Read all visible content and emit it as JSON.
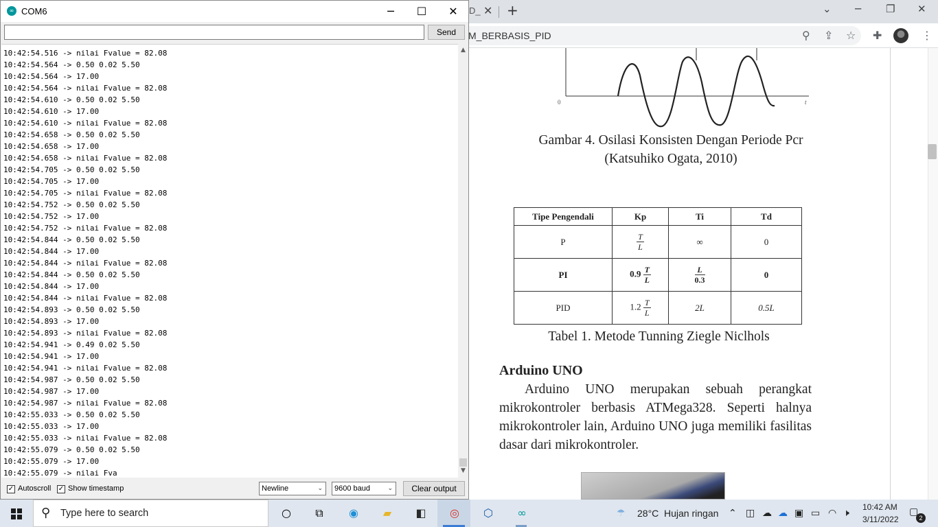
{
  "browser": {
    "tab_fragment": "D_",
    "url_fragment": "M_BERBASIS_PID",
    "document": {
      "figure_axis_origin": "0",
      "figure_axis_t": "t",
      "figure_caption_line1": "Gambar 4. Osilasi Konsisten Dengan Periode Pcr",
      "figure_caption_line2": "(Katsuhiko Ogata, 2010)",
      "table": {
        "headers": [
          "Tipe Pengendali",
          "Kp",
          "Ti",
          "Td"
        ],
        "rows": [
          {
            "type": "P",
            "kp_coef": "",
            "kp_num": "T",
            "kp_den": "L",
            "ti": "∞",
            "td": "0"
          },
          {
            "type": "PI",
            "kp_coef": "0.9",
            "kp_num": "T",
            "kp_den": "L",
            "ti_num": "L",
            "ti_den": "0.3",
            "td": "0"
          },
          {
            "type": "PID",
            "kp_coef": "1.2",
            "kp_num": "T",
            "kp_den": "L",
            "ti": "2L",
            "td": "0.5L"
          }
        ]
      },
      "table_caption": "Tabel 1. Metode Tunning Ziegle Niclhols",
      "section_title": "Arduino UNO",
      "paragraph": "Arduino UNO merupakan sebuah perangkat mikrokontroler berbasis ATMega328. Seperti halnya mikrokontroler lain, Arduino UNO juga memiliki fasilitas dasar dari mikrokontroler."
    }
  },
  "serial_monitor": {
    "title": "COM6",
    "input_value": "",
    "send_label": "Send",
    "lines": [
      "10:42:54.516 -> nilai Fvalue = 82.08",
      "10:42:54.564 -> 0.50 0.02 5.50",
      "10:42:54.564 -> 17.00",
      "10:42:54.564 -> nilai Fvalue = 82.08",
      "10:42:54.610 -> 0.50 0.02 5.50",
      "10:42:54.610 -> 17.00",
      "10:42:54.610 -> nilai Fvalue = 82.08",
      "10:42:54.658 -> 0.50 0.02 5.50",
      "10:42:54.658 -> 17.00",
      "10:42:54.658 -> nilai Fvalue = 82.08",
      "10:42:54.705 -> 0.50 0.02 5.50",
      "10:42:54.705 -> 17.00",
      "10:42:54.705 -> nilai Fvalue = 82.08",
      "10:42:54.752 -> 0.50 0.02 5.50",
      "10:42:54.752 -> 17.00",
      "10:42:54.752 -> nilai Fvalue = 82.08",
      "10:42:54.844 -> 0.50 0.02 5.50",
      "10:42:54.844 -> 17.00",
      "10:42:54.844 -> nilai Fvalue = 82.08",
      "10:42:54.844 -> 0.50 0.02 5.50",
      "10:42:54.844 -> 17.00",
      "10:42:54.844 -> nilai Fvalue = 82.08",
      "10:42:54.893 -> 0.50 0.02 5.50",
      "10:42:54.893 -> 17.00",
      "10:42:54.893 -> nilai Fvalue = 82.08",
      "10:42:54.941 -> 0.49 0.02 5.50",
      "10:42:54.941 -> 17.00",
      "10:42:54.941 -> nilai Fvalue = 82.08",
      "10:42:54.987 -> 0.50 0.02 5.50",
      "10:42:54.987 -> 17.00",
      "10:42:54.987 -> nilai Fvalue = 82.08",
      "10:42:55.033 -> 0.50 0.02 5.50",
      "10:42:55.033 -> 17.00",
      "10:42:55.033 -> nilai Fvalue = 82.08",
      "10:42:55.079 -> 0.50 0.02 5.50",
      "10:42:55.079 -> 17.00",
      "10:42:55.079 -> nilai Fva"
    ],
    "autoscroll_label": "Autoscroll",
    "autoscroll_checked": true,
    "timestamp_label": "Show timestamp",
    "timestamp_checked": true,
    "line_ending": "Newline",
    "baud_rate": "9600 baud",
    "clear_label": "Clear output"
  },
  "taskbar": {
    "search_placeholder": "Type here to search",
    "weather_temp": "28°C",
    "weather_text": "Hujan ringan",
    "time": "10:42 AM",
    "date": "3/11/2022",
    "notification_count": "2",
    "icons": [
      "start-icon",
      "search-icon",
      "cortana-icon",
      "task-view-icon",
      "edge-icon",
      "file-explorer-icon",
      "sticky-notes-icon",
      "chrome-icon",
      "virtualbox-icon",
      "arduino-icon"
    ]
  }
}
